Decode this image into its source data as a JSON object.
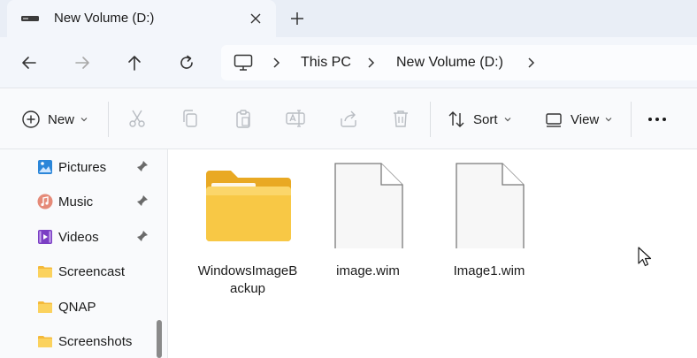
{
  "tab": {
    "title": "New Volume (D:)",
    "close_icon": "close-icon",
    "new_tab_icon": "plus-icon"
  },
  "nav": {
    "back_icon": "arrow-left-icon",
    "forward_icon": "arrow-right-icon",
    "up_icon": "arrow-up-icon",
    "refresh_icon": "refresh-icon"
  },
  "address": {
    "breadcrumbs": [
      "This PC",
      "New Volume (D:)"
    ]
  },
  "commands": {
    "new_label": "New",
    "sort_label": "Sort",
    "view_label": "View",
    "more_label": "..."
  },
  "sidebar": {
    "items": [
      {
        "label": "Pictures",
        "icon": "pictures-icon",
        "pinned": true
      },
      {
        "label": "Music",
        "icon": "music-icon",
        "pinned": true
      },
      {
        "label": "Videos",
        "icon": "videos-icon",
        "pinned": true
      },
      {
        "label": "Screencast",
        "icon": "folder-icon",
        "pinned": false
      },
      {
        "label": "QNAP",
        "icon": "folder-icon",
        "pinned": false
      },
      {
        "label": "Screenshots",
        "icon": "folder-icon",
        "pinned": false
      }
    ]
  },
  "files": [
    {
      "name": "WindowsImageBackup",
      "type": "folder"
    },
    {
      "name": "image.wim",
      "type": "file"
    },
    {
      "name": "Image1.wim",
      "type": "file"
    }
  ],
  "colors": {
    "accent": "#0067c0",
    "folder_yellow": "#f8c845",
    "tab_strip": "#e9eef6"
  }
}
